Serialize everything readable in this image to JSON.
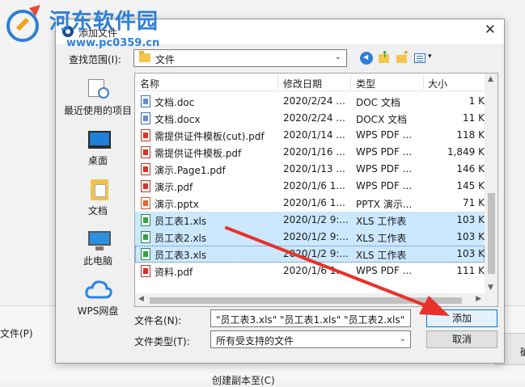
{
  "watermark": {
    "title": "河东软件园",
    "url": "www.pc0359.cn"
  },
  "dialog": {
    "title": "添加文件",
    "close_glyph": "✕",
    "look_in_label": "查找范围(I):",
    "look_in_value": "文件"
  },
  "places": [
    {
      "label": "最近使用的项目",
      "icon": "recent-icon"
    },
    {
      "label": "桌面",
      "icon": "desktop-icon"
    },
    {
      "label": "文档",
      "icon": "documents-icon"
    },
    {
      "label": "此电脑",
      "icon": "computer-icon"
    },
    {
      "label": "WPS网盘",
      "icon": "wps-cloud-icon"
    }
  ],
  "columns": {
    "name": "名称",
    "date": "修改日期",
    "type": "类型",
    "size": "大小"
  },
  "files": [
    {
      "name": "文档.doc",
      "date": "2020/2/24 ...",
      "type": "DOC 文档",
      "size": "1 K",
      "kind": "doc",
      "selected": false
    },
    {
      "name": "文档.docx",
      "date": "2020/2/24 ...",
      "type": "DOCX 文档",
      "size": "11 K",
      "kind": "doc",
      "selected": false
    },
    {
      "name": "需提供证件模板(cut).pdf",
      "date": "2020/1/14 ...",
      "type": "WPS PDF ...",
      "size": "118 K",
      "kind": "pdf",
      "selected": false
    },
    {
      "name": "需提供证件模板.pdf",
      "date": "2020/1/16 ...",
      "type": "WPS PDF ...",
      "size": "1,849 K",
      "kind": "pdf",
      "selected": false
    },
    {
      "name": "演示.Page1.pdf",
      "date": "2020/1/13 ...",
      "type": "WPS PDF ...",
      "size": "146 K",
      "kind": "pdf",
      "selected": false
    },
    {
      "name": "演示.pdf",
      "date": "2020/1/6 1...",
      "type": "WPS PDF ...",
      "size": "145 K",
      "kind": "pdf",
      "selected": false
    },
    {
      "name": "演示.pptx",
      "date": "2020/1/6 1...",
      "type": "PPTX 演示...",
      "size": "71 K",
      "kind": "ppt",
      "selected": false
    },
    {
      "name": "员工表1.xls",
      "date": "2020/1/2 9:...",
      "type": "XLS 工作表",
      "size": "103 K",
      "kind": "xls",
      "selected": true
    },
    {
      "name": "员工表2.xls",
      "date": "2020/1/2 9:...",
      "type": "XLS 工作表",
      "size": "103 K",
      "kind": "xls",
      "selected": true
    },
    {
      "name": "员工表3.xls",
      "date": "2020/1/2 9:...",
      "type": "XLS 工作表",
      "size": "103 K",
      "kind": "xls",
      "selected": true
    },
    {
      "name": "资料.pdf",
      "date": "2020/1/6 1...",
      "type": "WPS PDF ...",
      "size": "111 K",
      "kind": "pdf",
      "selected": false
    }
  ],
  "filename": {
    "label": "文件名(N):",
    "value": "\"员工表3.xls\" \"员工表1.xls\" \"员工表2.xls\""
  },
  "filetype": {
    "label": "文件类型(T):",
    "value": "所有受支持的文件"
  },
  "buttons": {
    "add": "添加",
    "cancel": "取消"
  },
  "background": {
    "left_label": "文件(P)",
    "bottom_label": "创建副本至(C)",
    "right_label": "确"
  },
  "colors": {
    "selection": "#cce8ff",
    "accent": "#0078d7",
    "annotation_arrow": "#e8322b",
    "watermark": "#2f7fd6"
  }
}
